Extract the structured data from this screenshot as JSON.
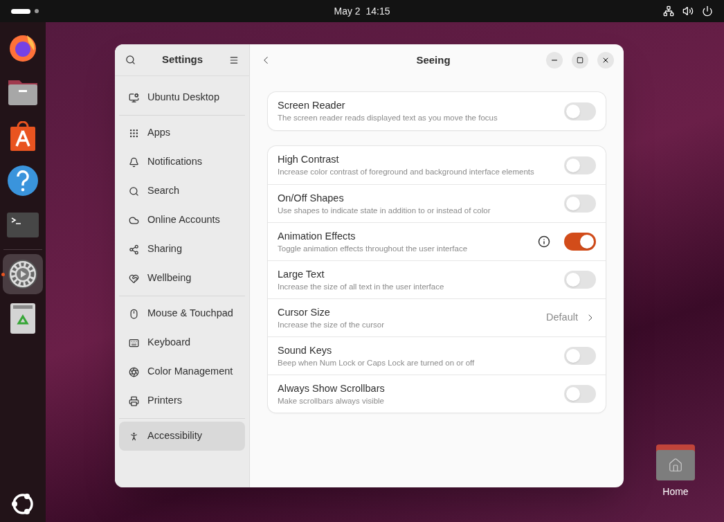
{
  "top_bar": {
    "clock": "May 2  14:15"
  },
  "dock": [
    {
      "kind": "browser",
      "selected": false
    },
    {
      "kind": "files",
      "selected": false
    },
    {
      "kind": "store",
      "selected": false
    },
    {
      "kind": "help",
      "selected": false
    },
    {
      "kind": "terminal",
      "selected": false
    },
    {
      "kind": "settings",
      "selected": true
    },
    {
      "kind": "trash",
      "selected": false
    }
  ],
  "desktop_icons": [
    {
      "label": "Home"
    }
  ],
  "window": {
    "sidebar_title": "Settings",
    "title": "Seeing"
  },
  "sidebar": {
    "groups": [
      {
        "items": [
          {
            "kind": "desktop",
            "label": "Ubuntu Desktop",
            "selected": false
          }
        ]
      },
      {
        "items": [
          {
            "kind": "apps",
            "label": "Apps",
            "selected": false
          },
          {
            "kind": "bell",
            "label": "Notifications",
            "selected": false
          },
          {
            "kind": "search",
            "label": "Search",
            "selected": false
          },
          {
            "kind": "cloud",
            "label": "Online Accounts",
            "selected": false
          },
          {
            "kind": "share",
            "label": "Sharing",
            "selected": false
          },
          {
            "kind": "heart",
            "label": "Wellbeing",
            "selected": false
          }
        ]
      },
      {
        "items": [
          {
            "kind": "mouse",
            "label": "Mouse & Touchpad",
            "selected": false
          },
          {
            "kind": "keyboard",
            "label": "Keyboard",
            "selected": false
          },
          {
            "kind": "color",
            "label": "Color Management",
            "selected": false
          },
          {
            "kind": "printer",
            "label": "Printers",
            "selected": false
          }
        ]
      },
      {
        "items": [
          {
            "kind": "person",
            "label": "Accessibility",
            "selected": true
          }
        ]
      }
    ]
  },
  "sections": [
    {
      "rows": [
        {
          "kind": "switch",
          "title": "Screen Reader",
          "subtitle": "The screen reader reads displayed text as you move the focus",
          "on": false,
          "info": false
        }
      ]
    },
    {
      "rows": [
        {
          "kind": "switch",
          "title": "High Contrast",
          "subtitle": "Increase color contrast of foreground and background interface elements",
          "on": false,
          "info": false
        },
        {
          "kind": "switch",
          "title": "On/Off Shapes",
          "subtitle": "Use shapes to indicate state in addition to or instead of color",
          "on": false,
          "info": false
        },
        {
          "kind": "switch",
          "title": "Animation Effects",
          "subtitle": "Toggle animation effects throughout the user interface",
          "on": true,
          "info": true
        },
        {
          "kind": "switch",
          "title": "Large Text",
          "subtitle": "Increase the size of all text in the user interface",
          "on": false,
          "info": false
        },
        {
          "kind": "value",
          "title": "Cursor Size",
          "subtitle": "Increase the size of the cursor",
          "value": "Default"
        },
        {
          "kind": "switch",
          "title": "Sound Keys",
          "subtitle": "Beep when Num Lock or Caps Lock are turned on or off",
          "on": false,
          "info": false
        },
        {
          "kind": "switch",
          "title": "Always Show Scrollbars",
          "subtitle": "Make scrollbars always visible",
          "on": false,
          "info": false
        }
      ]
    }
  ]
}
